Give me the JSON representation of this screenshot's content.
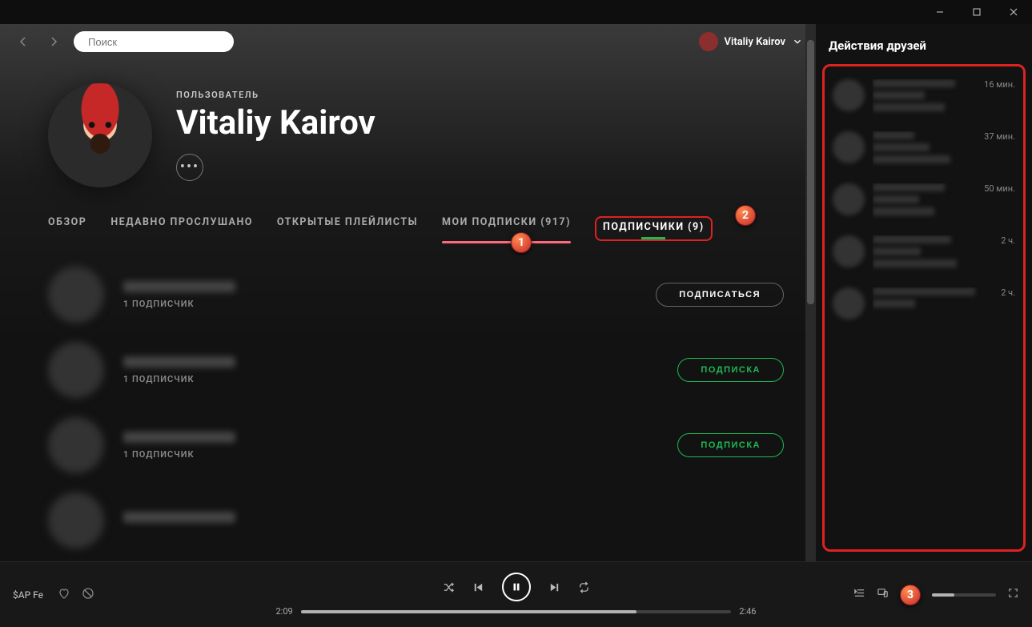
{
  "window": {
    "minimize": "–",
    "maximize": "□",
    "close": "✕"
  },
  "search": {
    "placeholder": "Поиск"
  },
  "user": {
    "name": "Vitaliy Kairov"
  },
  "profile": {
    "type_label": "ПОЛЬЗОВАТЕЛЬ",
    "name": "Vitaliy Kairov"
  },
  "tabs": {
    "overview": "ОБЗОР",
    "recent": "НЕДАВНО ПРОСЛУШАНО",
    "playlists": "ОТКРЫТЫЕ ПЛЕЙЛИСТЫ",
    "following": "МОИ ПОДПИСКИ (917)",
    "followers": "ПОДПИСЧИКИ (9)"
  },
  "markers": {
    "m1": "1",
    "m2": "2",
    "m3": "3"
  },
  "followers_list": [
    {
      "sub": "1 ПОДПИСЧИК",
      "action": "ПОДПИСАТЬСЯ",
      "style": "outline"
    },
    {
      "sub": "1 ПОДПИСЧИК",
      "action": "ПОДПИСКА",
      "style": "green"
    },
    {
      "sub": "1 ПОДПИСЧИК",
      "action": "ПОДПИСКА",
      "style": "green"
    }
  ],
  "friends": {
    "title": "Действия друзей",
    "items": [
      {
        "time": "16 мин."
      },
      {
        "time": "37 мин."
      },
      {
        "time": "50 мин."
      },
      {
        "time": "2 ч."
      },
      {
        "time": "2 ч."
      }
    ]
  },
  "player": {
    "track": "$AP Fe",
    "elapsed": "2:09",
    "total": "2:46"
  }
}
